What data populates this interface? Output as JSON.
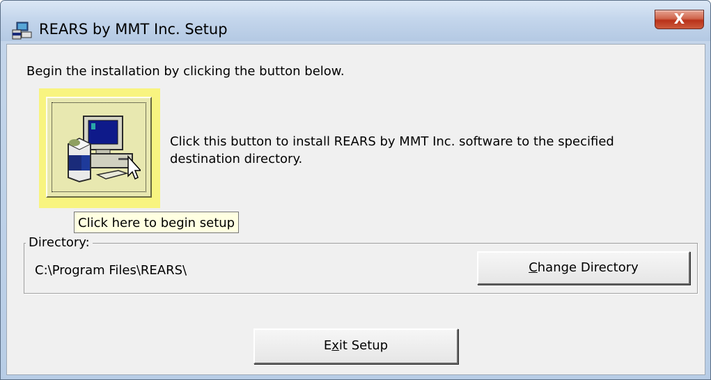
{
  "window": {
    "title": "REARS by MMT Inc. Setup",
    "close_label": "X"
  },
  "intro": {
    "text": "Begin the installation by clicking the button below."
  },
  "install": {
    "icon": "computer-install-icon",
    "description": "Click this button to install REARS by MMT Inc. software to the specified destination directory.",
    "tooltip": "Click here to begin setup"
  },
  "directory": {
    "label": "Directory:",
    "path": "C:\\Program Files\\REARS\\",
    "change_button": {
      "prefix": "",
      "accel": "C",
      "suffix": "hange Directory"
    }
  },
  "exit_button": {
    "prefix": "E",
    "accel": "x",
    "suffix": "it Setup"
  },
  "colors": {
    "install_highlight": "#f8f480",
    "tooltip_bg": "#ffffe1",
    "close_button": "#c0392b"
  }
}
